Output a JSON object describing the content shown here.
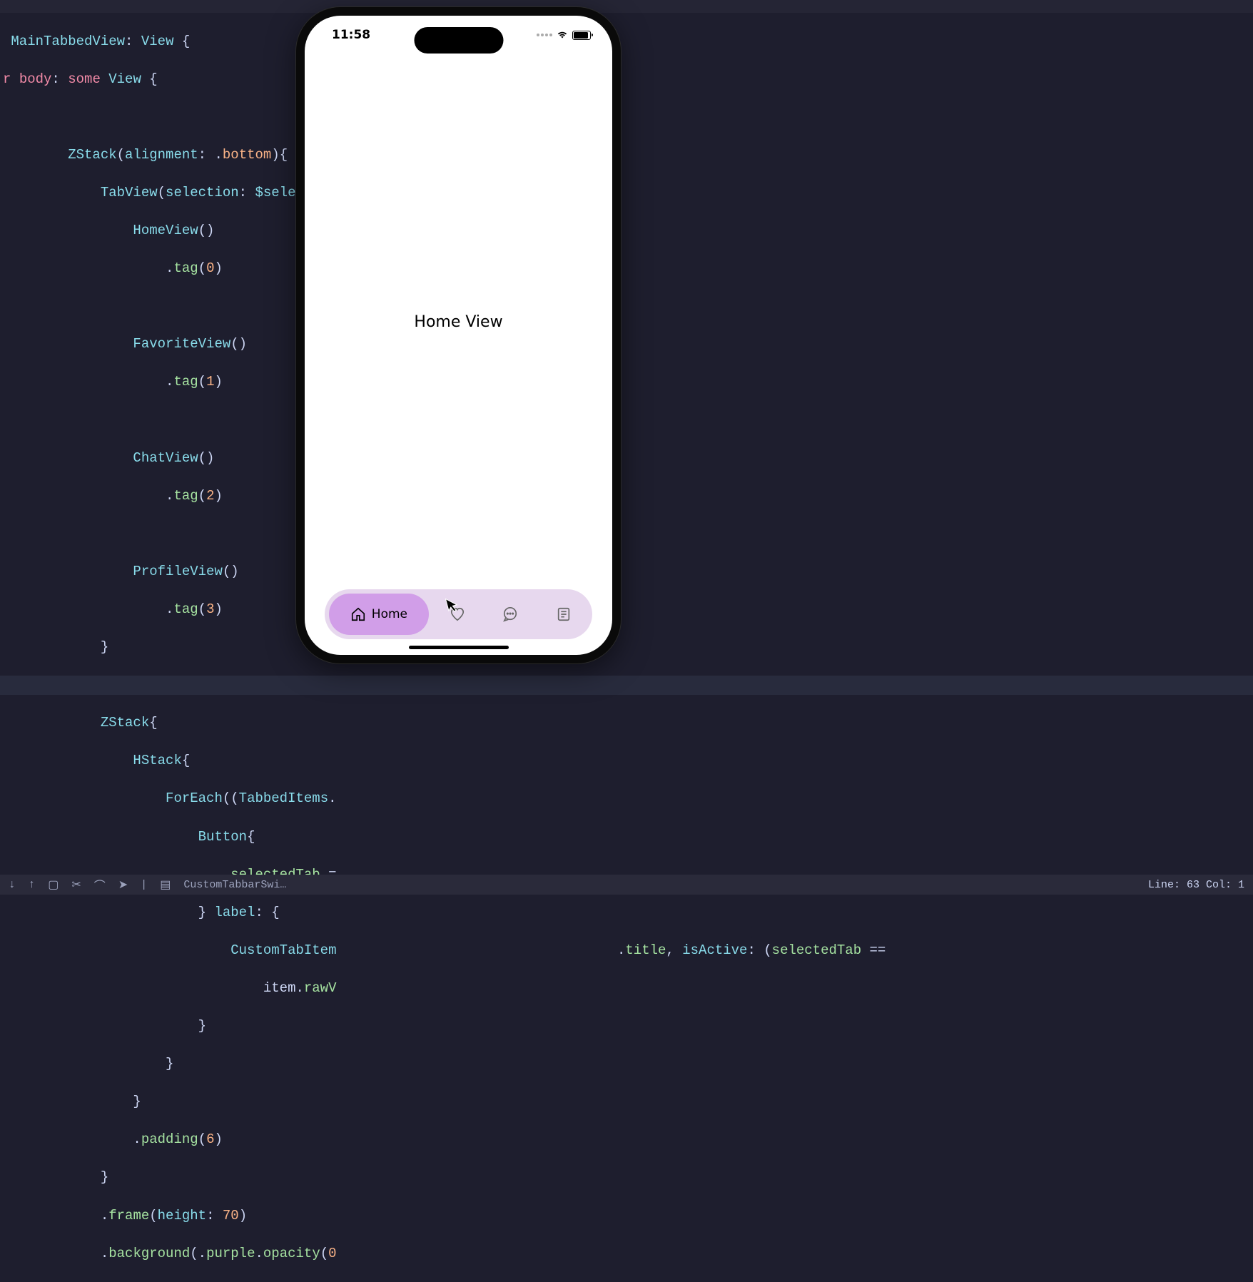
{
  "code": {
    "l1a": "MainTabbedView",
    "l1b": ": ",
    "l1c": "View",
    "l1d": " {",
    "l2a": "r ",
    "l2b": "body",
    "l2c": ": ",
    "l2d": "some",
    "l2e": " View",
    "l2f": " {",
    "l3a": "        ZStack",
    "l3b": "(",
    "l3c": "alignment",
    "l3d": ": .",
    "l3e": "bottom",
    "l3f": "){",
    "l4a": "            TabView",
    "l4b": "(",
    "l4c": "selection",
    "l4d": ": ",
    "l4e": "$selectedT",
    "l5a": "                HomeView",
    "l5b": "()",
    "l6a": "                    .",
    "l6b": "tag",
    "l6c": "(",
    "l6d": "0",
    "l6e": ")",
    "l7a": "                FavoriteView",
    "l7b": "()",
    "l8a": "                    .",
    "l8b": "tag",
    "l8c": "(",
    "l8d": "1",
    "l8e": ")",
    "l9a": "                ChatView",
    "l9b": "()",
    "l10a": "                    .",
    "l10b": "tag",
    "l10c": "(",
    "l10d": "2",
    "l10e": ")",
    "l11a": "                ProfileView",
    "l11b": "()",
    "l12a": "                    .",
    "l12b": "tag",
    "l12c": "(",
    "l12d": "3",
    "l12e": ")",
    "l13a": "            }",
    "l14a": "            ZStack",
    "l14b": "{",
    "l15a": "                HStack",
    "l15b": "{",
    "l16a": "                    ForEach",
    "l16b": "((",
    "l16c": "TabbedItems",
    "l16d": ".",
    "l17a": "                        Button",
    "l17b": "{",
    "l18a": "                            selectedTab",
    "l18b": " =",
    "l19a": "                        } ",
    "l19b": "label",
    "l19c": ": {",
    "l20a": "                            CustomTabItem",
    "l20r1": ".",
    "l20r2": "title",
    "l20r3": ", ",
    "l20r4": "isActive",
    "l20r5": ": (",
    "l20r6": "selectedTab",
    "l20r7": " ==",
    "l21a": "                                item.",
    "l21b": "rawV",
    "l22a": "                        }",
    "l23a": "                    }",
    "l24a": "                }",
    "l25a": "                .",
    "l25b": "padding",
    "l25c": "(",
    "l25d": "6",
    "l25e": ")",
    "l26a": "            }",
    "l27a": "            .",
    "l27b": "frame",
    "l27c": "(",
    "l27d": "height",
    "l27e": ": ",
    "l27f": "70",
    "l27g": ")",
    "l28a": "            .",
    "l28b": "background",
    "l28c": "(.",
    "l28d": "purple",
    "l28e": ".",
    "l28f": "opacity",
    "l28g": "(",
    "l28h": "0"
  },
  "phone": {
    "time": "11:58",
    "content_text": "Home View",
    "tabs": [
      {
        "label": "Home",
        "icon": "home-icon",
        "active": true
      },
      {
        "label": "",
        "icon": "heart-icon",
        "active": false
      },
      {
        "label": "",
        "icon": "chat-icon",
        "active": false
      },
      {
        "label": "",
        "icon": "profile-icon",
        "active": false
      }
    ]
  },
  "statusbar": {
    "file": "CustomTabbarSwi…",
    "position": "Line: 63  Col: 1"
  }
}
